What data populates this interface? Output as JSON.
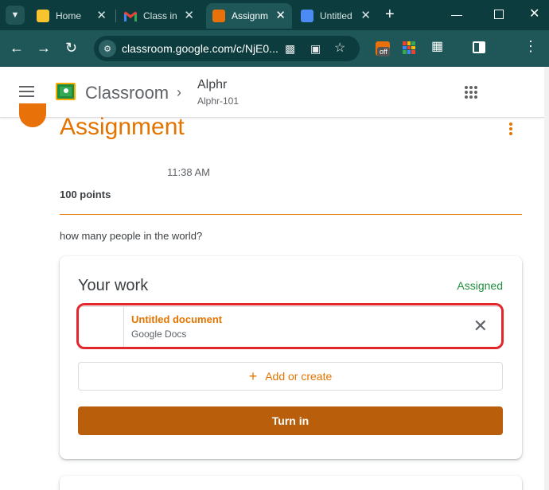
{
  "browser": {
    "tabs": [
      {
        "title": "Home",
        "favicon": "classroom-icon",
        "active": false
      },
      {
        "title": "Class in",
        "favicon": "gmail-icon",
        "active": false
      },
      {
        "title": "Assignm",
        "favicon": "classroom-icon",
        "active": true
      },
      {
        "title": "Untitled",
        "favicon": "docs-icon",
        "active": false
      }
    ],
    "url": "classroom.google.com/c/NjE0...",
    "extension_badge": "off"
  },
  "header": {
    "app_name": "Classroom",
    "class_name": "Alphr",
    "class_section": "Alphr-101"
  },
  "assignment": {
    "title": "Assignment",
    "time": "11:38 AM",
    "points": "100 points",
    "question": "how many people in the world?"
  },
  "your_work": {
    "title": "Your work",
    "status": "Assigned",
    "attachment": {
      "name": "Untitled document",
      "type": "Google Docs"
    },
    "add_label": "Add or create",
    "turn_in_label": "Turn in"
  },
  "colors": {
    "accent": "#e37400",
    "turn_in_bg": "#b95e0b",
    "assigned": "#1e8e3e",
    "highlight": "#e3262b",
    "chrome_dark": "#0c3c3d",
    "chrome_toolbar": "#1f5758"
  }
}
